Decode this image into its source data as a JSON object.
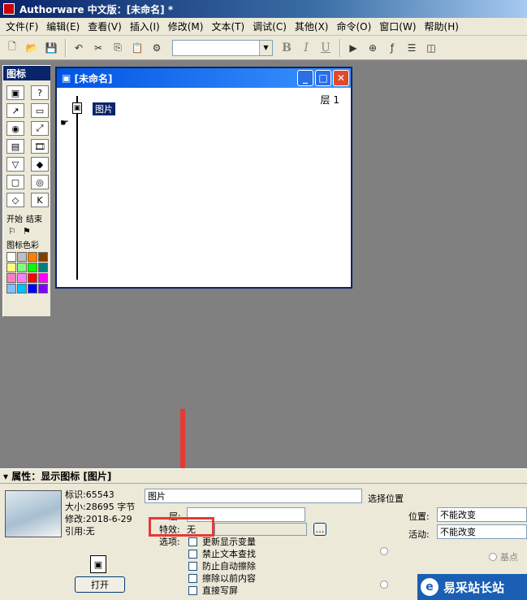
{
  "app": {
    "title": "Authorware 中文版：[未命名] *"
  },
  "menubar": [
    "文件(F)",
    "编辑(E)",
    "查看(V)",
    "插入(I)",
    "修改(M)",
    "文本(T)",
    "调试(C)",
    "其他(X)",
    "命令(O)",
    "窗口(W)",
    "帮助(H)"
  ],
  "toolbar": {
    "bold": "B",
    "italic": "I",
    "underline": "U"
  },
  "palette": {
    "title": "图标",
    "start_label": "开始",
    "end_label": "结束",
    "color_label": "图标色彩",
    "swatch_colors": [
      "#ffffff",
      "#c0c0c0",
      "#ff8000",
      "#804000",
      "#ffff80",
      "#80ff80",
      "#00ff00",
      "#008080",
      "#ff80c0",
      "#ff80ff",
      "#ff0000",
      "#ff00ff",
      "#80c0ff",
      "#00c0ff",
      "#0000ff",
      "#8000ff"
    ]
  },
  "flowwin": {
    "title": "[未命名]",
    "layer": "层 1",
    "icon_label": "图片"
  },
  "props": {
    "title": "属性：显示图标 [图片]",
    "id_label": "标识:65543",
    "size_label": "大小:28695 字节",
    "modified_label": "修改:2018-6-29",
    "ref_label": "引用:无",
    "open_button": "打开",
    "name_value": "图片",
    "select_position": "选择位置",
    "layer_label": "层:",
    "effect_label": "特效:",
    "effect_value": "无",
    "options_label": "选项:",
    "checkboxes": [
      "更新显示变量",
      "禁止文本查找",
      "防止自动擦除",
      "擦除以前内容",
      "直接写屏"
    ],
    "position_label": "位置:",
    "position_value": "不能改变",
    "activity_label": "活动:",
    "activity_value": "不能改变",
    "base_point": "基点"
  },
  "watermark": {
    "text": "易采站长站"
  }
}
